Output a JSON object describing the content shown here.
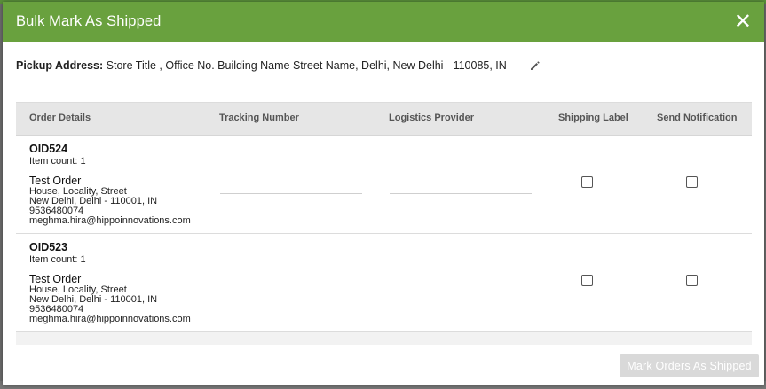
{
  "modal": {
    "title": "Bulk Mark As Shipped",
    "close_icon": "close-icon"
  },
  "pickup": {
    "label": "Pickup Address:",
    "address": "Store Title , Office No. Building Name Street Name, Delhi, New Delhi - 110085, IN",
    "edit_icon": "pencil-icon"
  },
  "table": {
    "headers": [
      "Order Details",
      "Tracking Number",
      "Logistics Provider",
      "Shipping Label",
      "Send Notification"
    ],
    "rows": [
      {
        "order_id": "OID524",
        "item_count": "Item count: 1",
        "customer": "Test Order",
        "address_line1": "House, Locality, Street",
        "address_line2": "New Delhi, Delhi - 110001, IN",
        "phone": "9536480074",
        "email": "meghma.hira@hippoinnovations.com",
        "tracking_number": "",
        "logistics_provider": "",
        "shipping_label": false,
        "send_notification": false
      },
      {
        "order_id": "OID523",
        "item_count": "Item count: 1",
        "customer": "Test Order",
        "address_line1": "House, Locality, Street",
        "address_line2": "New Delhi, Delhi - 110001, IN",
        "phone": "9536480074",
        "email": "meghma.hira@hippoinnovations.com",
        "tracking_number": "",
        "logistics_provider": "",
        "shipping_label": false,
        "send_notification": false
      }
    ]
  },
  "footer": {
    "submit_label": "Mark Orders As Shipped"
  },
  "colors": {
    "header_green": "#69a13e",
    "disabled_button": "#d9d9d9"
  }
}
